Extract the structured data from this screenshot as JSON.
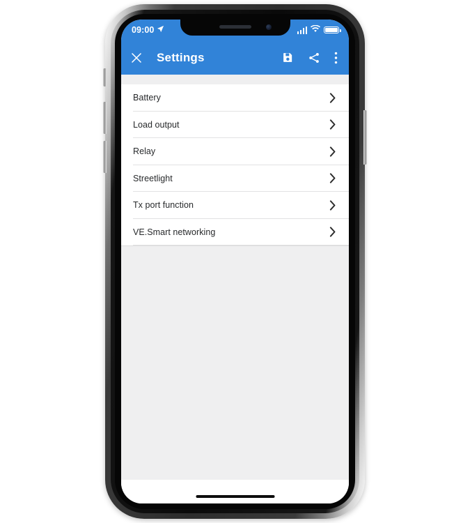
{
  "device": {
    "frame": "iphone-x",
    "home_indicator": true
  },
  "status_bar": {
    "time": "09:00",
    "location_icon": "location-arrow-icon",
    "signal_icon": "cellular-signal-icon",
    "signal_bars": 4,
    "wifi_icon": "wifi-icon",
    "battery_icon": "battery-full-icon",
    "battery_level": 100
  },
  "app_bar": {
    "close_label": "×",
    "close_icon": "close-icon",
    "title": "Settings",
    "actions": [
      {
        "name": "save-button",
        "icon": "save-floppy-icon"
      },
      {
        "name": "share-button",
        "icon": "share-icon"
      },
      {
        "name": "overflow-menu-button",
        "icon": "more-vertical-icon"
      }
    ]
  },
  "settings_list": {
    "items": [
      {
        "label": "Battery",
        "chevron": "chevron-right-icon"
      },
      {
        "label": "Load output",
        "chevron": "chevron-right-icon"
      },
      {
        "label": "Relay",
        "chevron": "chevron-right-icon"
      },
      {
        "label": "Streetlight",
        "chevron": "chevron-right-icon"
      },
      {
        "label": "Tx port function",
        "chevron": "chevron-right-icon"
      },
      {
        "label": "VE.Smart networking",
        "chevron": "chevron-right-icon"
      }
    ]
  },
  "colors": {
    "app_bar_blue": "#3183d8",
    "page_background": "#efeff0",
    "list_background": "#ffffff",
    "divider": "#e2e2e3",
    "text_primary": "#27292b",
    "on_primary": "#ffffff"
  }
}
